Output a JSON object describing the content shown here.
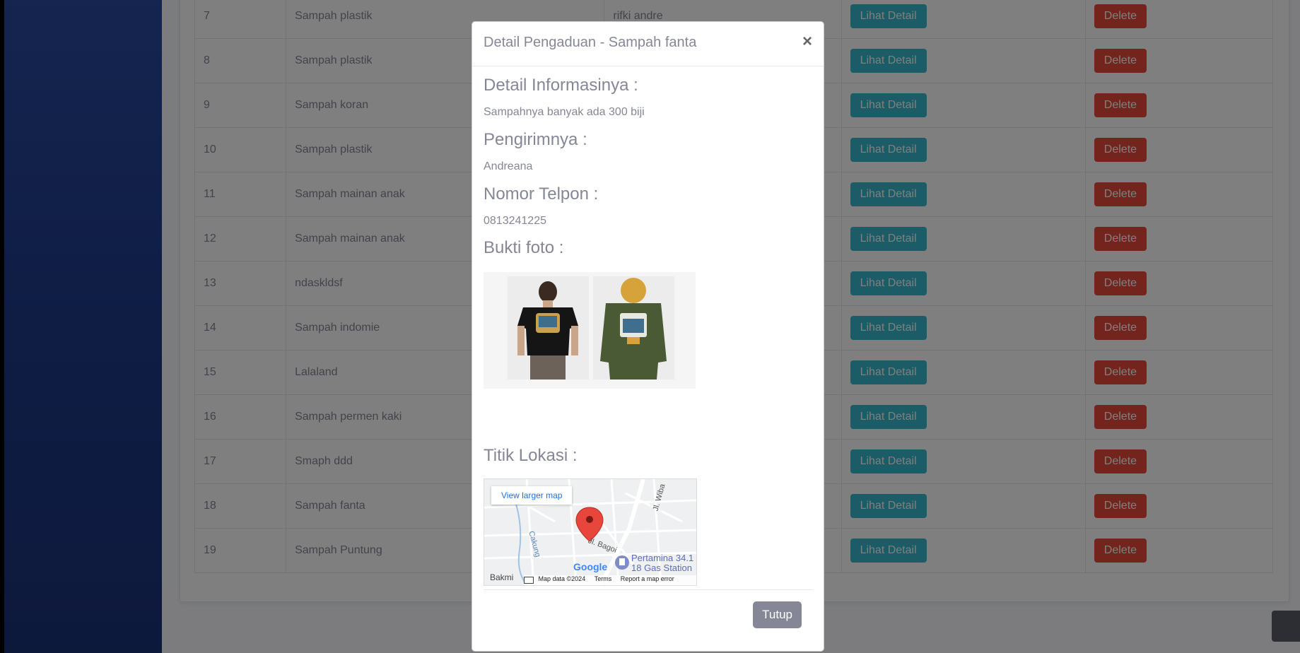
{
  "table": {
    "rows": [
      {
        "no": "7",
        "title": "Sampah plastik",
        "sender": "rifki andre"
      },
      {
        "no": "8",
        "title": "Sampah plastik",
        "sender": ""
      },
      {
        "no": "9",
        "title": "Sampah koran",
        "sender": ""
      },
      {
        "no": "10",
        "title": "Sampah plastik",
        "sender": ""
      },
      {
        "no": "11",
        "title": "Sampah mainan anak",
        "sender": ""
      },
      {
        "no": "12",
        "title": "Sampah mainan anak",
        "sender": ""
      },
      {
        "no": "13",
        "title": "ndaskldsf",
        "sender": ""
      },
      {
        "no": "14",
        "title": "Sampah indomie",
        "sender": ""
      },
      {
        "no": "15",
        "title": "Lalaland",
        "sender": ""
      },
      {
        "no": "16",
        "title": "Sampah permen kaki",
        "sender": ""
      },
      {
        "no": "17",
        "title": "Smaph ddd",
        "sender": ""
      },
      {
        "no": "18",
        "title": "Sampah fanta",
        "sender": ""
      },
      {
        "no": "19",
        "title": "Sampah Puntung",
        "sender": ""
      }
    ],
    "detail_label": "Lihat Detail",
    "delete_label": "Delete"
  },
  "modal": {
    "title": "Detail Pengaduan - Sampah fanta",
    "close": "×",
    "info_heading": "Detail Informasinya :",
    "info_text": "Sampahnya banyak ada 300 biji",
    "sender_heading": "Pengirimnya :",
    "sender_text": "Andreana",
    "phone_heading": "Nomor Telpon :",
    "phone_text": "0813241225",
    "photo_heading": "Bukti foto :",
    "location_heading": "Titik Lokasi :",
    "close_button": "Tutup"
  },
  "map": {
    "view_larger": "View larger map",
    "street1": "Jl. Wiba",
    "street2": "Jl. Bagoi",
    "street3": "Cakung",
    "place_name": "Pertamina 34.1",
    "place_sub": "18 Gas Station",
    "area": "Bakmi",
    "brand": "Google",
    "map_data": "Map data ©2024",
    "terms": "Terms",
    "report": "Report a map error"
  },
  "colors": {
    "sidebar": "#1e3a8a",
    "info": "#36b9cc",
    "danger": "#e74a3b",
    "secondary": "#858796"
  }
}
